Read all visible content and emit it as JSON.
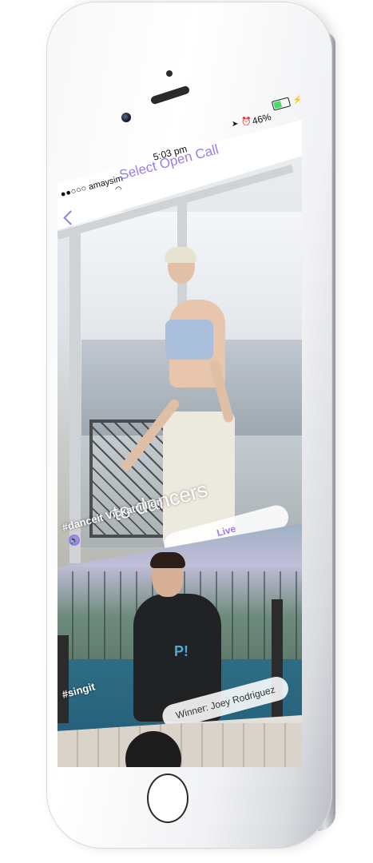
{
  "status_bar": {
    "carrier": "●●○○○ amaysim",
    "time": "5:03 pm",
    "battery_percent": "46%"
  },
  "nav": {
    "title": "Select Open Call",
    "back_icon": "chevron-left-icon"
  },
  "cards": [
    {
      "overlay_text": "to dancers",
      "hashtag": "#danceit Vickatrillion",
      "status_pill": "Live",
      "sound_icon": "speaker-icon"
    },
    {
      "hashtag": "#singit",
      "status_pill": "Winner: Joey Rodriguez"
    }
  ],
  "colors": {
    "accent": "#9a7ce6",
    "status_text": "#111111"
  }
}
